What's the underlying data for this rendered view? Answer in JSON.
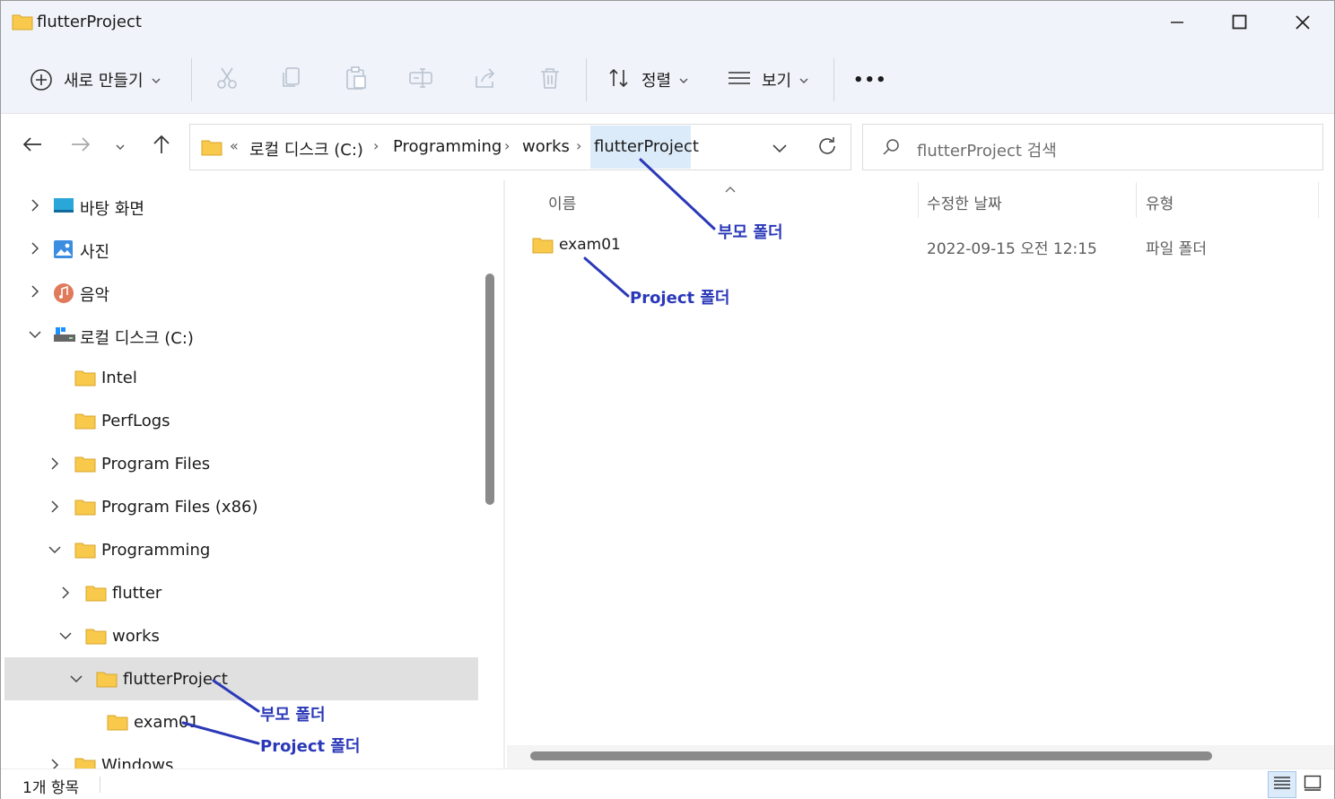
{
  "window": {
    "title": "flutterProject"
  },
  "toolbar": {
    "new_label": "새로 만들기",
    "sort_label": "정렬",
    "view_label": "보기",
    "more_label": "•••"
  },
  "address": {
    "overflow": "«",
    "crumbs": [
      "로컬 디스크 (C:)",
      "Programming",
      "works",
      "flutterProject"
    ]
  },
  "search": {
    "placeholder": "flutterProject 검색"
  },
  "sidebar": {
    "items": [
      {
        "label": "바탕 화면",
        "icon": "desktop-icon",
        "expander": "collapsed"
      },
      {
        "label": "사진",
        "icon": "pictures-icon",
        "expander": "collapsed"
      },
      {
        "label": "음악",
        "icon": "music-icon",
        "expander": "collapsed"
      },
      {
        "label": "로컬 디스크 (C:)",
        "icon": "drive-icon",
        "expander": "expanded"
      },
      {
        "label": "Intel",
        "icon": "folder-icon",
        "expander": "none"
      },
      {
        "label": "PerfLogs",
        "icon": "folder-icon",
        "expander": "none"
      },
      {
        "label": "Program Files",
        "icon": "folder-icon",
        "expander": "collapsed"
      },
      {
        "label": "Program Files (x86)",
        "icon": "folder-icon",
        "expander": "collapsed"
      },
      {
        "label": "Programming",
        "icon": "folder-icon",
        "expander": "expanded"
      },
      {
        "label": "flutter",
        "icon": "folder-icon",
        "expander": "collapsed"
      },
      {
        "label": "works",
        "icon": "folder-icon",
        "expander": "expanded"
      },
      {
        "label": "flutterProject",
        "icon": "folder-icon",
        "expander": "expanded",
        "selected": true
      },
      {
        "label": "exam01",
        "icon": "folder-icon",
        "expander": "none"
      },
      {
        "label": "Windows",
        "icon": "folder-icon",
        "expander": "collapsed"
      }
    ]
  },
  "content": {
    "columns": [
      "이름",
      "수정한 날짜",
      "유형"
    ],
    "rows": [
      {
        "name": "exam01",
        "modified": "2022-09-15 오전 12:15",
        "type": "파일 폴더"
      }
    ]
  },
  "status": {
    "item_count": "1개 항목"
  },
  "annotations": {
    "parent_folder": "부모 폴더",
    "project_folder": "Project 폴더"
  },
  "colors": {
    "annotation": "#2b39b8",
    "folder": "#f8c94a",
    "selection": "#e0e0e0",
    "accent": "#dcebf9"
  }
}
